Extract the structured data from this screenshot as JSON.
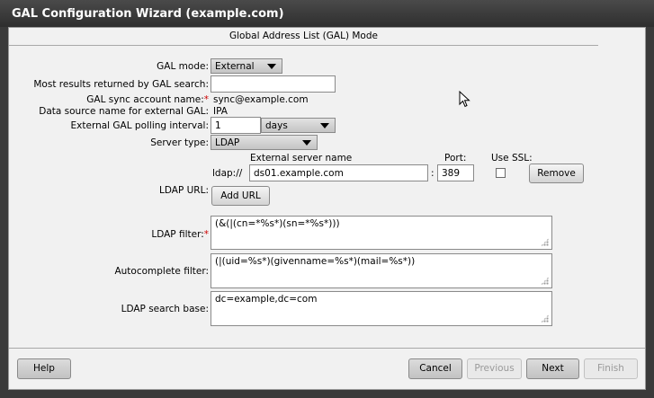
{
  "window": {
    "title": "GAL Configuration Wizard (example.com)"
  },
  "header": {
    "title": "Global Address List (GAL) Mode"
  },
  "form": {
    "gal_mode": {
      "label": "GAL mode:",
      "value": "External"
    },
    "max_results": {
      "label": "Most results returned by GAL search:",
      "value": ""
    },
    "sync_account": {
      "label": "GAL sync account name:",
      "value": "sync@example.com"
    },
    "data_source": {
      "label": "Data source name for external GAL:",
      "value": "IPA"
    },
    "polling": {
      "label": "External GAL polling interval:",
      "value": "1",
      "unit": "days"
    },
    "server_type": {
      "label": "Server type:",
      "value": "LDAP"
    },
    "ldap_url": {
      "label": "LDAP URL:",
      "col_server": "External server name",
      "col_port": "Port:",
      "col_ssl": "Use SSL:",
      "prefix": "ldap://",
      "separator": ":",
      "server": "ds01.example.com",
      "port": "389",
      "remove_label": "Remove",
      "add_label": "Add URL"
    },
    "ldap_filter": {
      "label": "LDAP filter:",
      "value": "(&(|(cn=*%s*)(sn=*%s*)))"
    },
    "autocomplete_filter": {
      "label": "Autocomplete filter:",
      "value": "(|(uid=%s*)(givenname=%s*)(mail=%s*))"
    },
    "search_base": {
      "label": "LDAP search base:",
      "value": "dc=example,dc=com"
    },
    "required_mark": "*"
  },
  "footer": {
    "help": "Help",
    "cancel": "Cancel",
    "previous": "Previous",
    "next": "Next",
    "finish": "Finish"
  }
}
